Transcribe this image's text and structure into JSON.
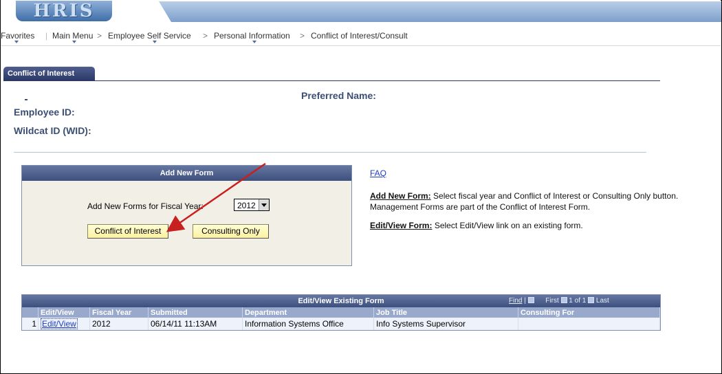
{
  "header": {
    "logo_text": "HRIS"
  },
  "breadcrumb": {
    "favorites": "Favorites",
    "main_menu": "Main Menu",
    "employee_self_service": "Employee Self Service",
    "personal_information": "Personal Information",
    "current": "Conflict of Interest/Consult",
    "separator": ">"
  },
  "tab": {
    "label": "Conflict of Interest"
  },
  "employee": {
    "preferred_name_label": "Preferred Name:",
    "employee_id_label": "Employee ID:",
    "wildcat_id_label": "Wildcat ID (WID):"
  },
  "add_new_form": {
    "title": "Add New Form",
    "fiscal_year_label": "Add New Forms for Fiscal Year:",
    "fiscal_year_value": "2012",
    "conflict_button": "Conflict of Interest",
    "consulting_button": "Consulting Only"
  },
  "help": {
    "faq_link": "FAQ",
    "add_title": "Add New Form:",
    "add_text": "Select fiscal year and Conflict of Interest or Consulting Only button. Management Forms are part of the Conflict of Interest Form.",
    "edit_title": "Edit/View Form:",
    "edit_text": "Select Edit/View link on an existing form."
  },
  "existing_grid": {
    "title": "Edit/View Existing Form",
    "find": "Find",
    "first": "First",
    "range": "1 of 1",
    "last": "Last",
    "columns": [
      "Edit/View",
      "Fiscal Year",
      "Submitted",
      "Department",
      "Job Title",
      "Consulting For"
    ],
    "rows": [
      {
        "num": "1",
        "edit": "Edit/View",
        "fiscal_year": "2012",
        "submitted": "06/14/11 11:13AM",
        "department": "Information Systems Office",
        "job_title": "Info Systems Supervisor",
        "consulting_for": ""
      }
    ]
  },
  "colors": {
    "accent": "#3d4f7e",
    "button": "#fbf0a0",
    "annotation_arrow": "#c8201e"
  }
}
